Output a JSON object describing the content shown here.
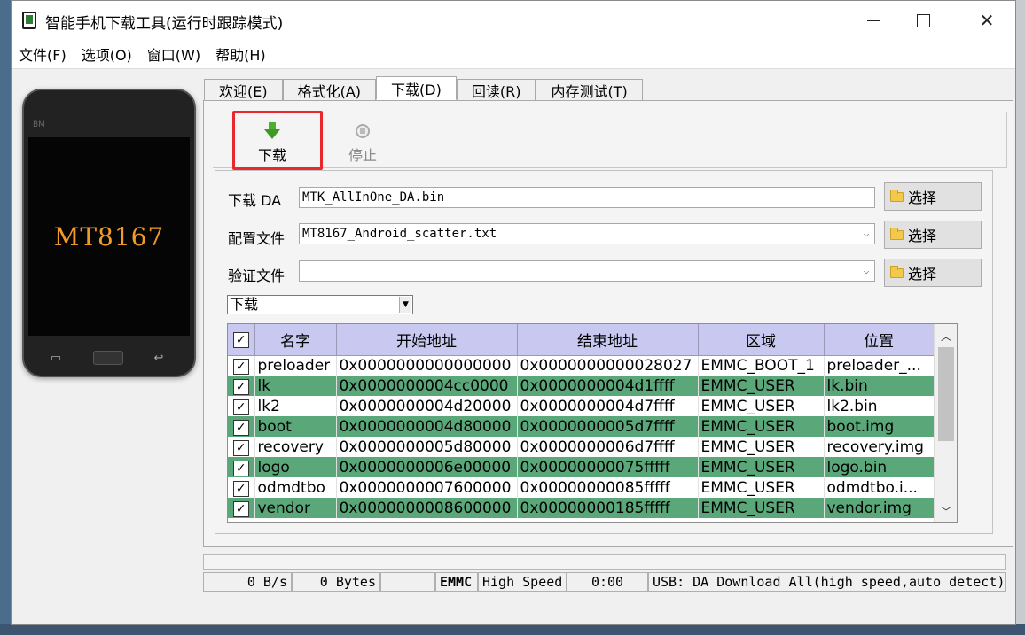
{
  "window": {
    "title": "智能手机下载工具(运行时跟踪模式)"
  },
  "menu": [
    "文件(F)",
    "选项(O)",
    "窗口(W)",
    "帮助(H)"
  ],
  "phone": {
    "brand": "BM",
    "model": "MT8167"
  },
  "tabs": [
    "欢迎(E)",
    "格式化(A)",
    "下载(D)",
    "回读(R)",
    "内存测试(T)"
  ],
  "active_tab": "下载(D)",
  "toolbar": {
    "download_label": "下载",
    "stop_label": "停止"
  },
  "fields": {
    "da_label": "下载 DA",
    "da_value": "MTK_AllInOne_DA.bin",
    "config_label": "配置文件",
    "config_value": "MT8167_Android_scatter.txt",
    "verify_label": "验证文件",
    "verify_value": "",
    "choose_label": "选择"
  },
  "mode_select": "下载",
  "table": {
    "headers": [
      "名字",
      "开始地址",
      "结束地址",
      "区域",
      "位置"
    ],
    "rows": [
      {
        "name": "preloader",
        "start": "0x0000000000000000",
        "end": "0x0000000000028027",
        "region": "EMMC_BOOT_1",
        "location": "preloader_..."
      },
      {
        "name": "lk",
        "start": "0x0000000004cc0000",
        "end": "0x0000000004d1ffff",
        "region": "EMMC_USER",
        "location": "lk.bin"
      },
      {
        "name": "lk2",
        "start": "0x0000000004d20000",
        "end": "0x0000000004d7ffff",
        "region": "EMMC_USER",
        "location": "lk2.bin"
      },
      {
        "name": "boot",
        "start": "0x0000000004d80000",
        "end": "0x0000000005d7ffff",
        "region": "EMMC_USER",
        "location": "boot.img"
      },
      {
        "name": "recovery",
        "start": "0x0000000005d80000",
        "end": "0x0000000006d7ffff",
        "region": "EMMC_USER",
        "location": "recovery.img"
      },
      {
        "name": "logo",
        "start": "0x0000000006e00000",
        "end": "0x00000000075fffff",
        "region": "EMMC_USER",
        "location": "logo.bin"
      },
      {
        "name": "odmdtbo",
        "start": "0x0000000007600000",
        "end": "0x00000000085fffff",
        "region": "EMMC_USER",
        "location": "odmdtbo.i..."
      },
      {
        "name": "vendor",
        "start": "0x0000000008600000",
        "end": "0x00000000185fffff",
        "region": "EMMC_USER",
        "location": "vendor.img"
      }
    ]
  },
  "status": {
    "speed": "0 B/s",
    "bytes": "0 Bytes",
    "storage": "EMMC",
    "mode": "High Speed",
    "time": "0:00",
    "usb": "USB: DA Download All(high speed,auto detect)"
  },
  "colors": {
    "highlight": "#e8282c",
    "row_alt": "#5aa87a",
    "header_bg": "#c8c8f0",
    "phone_model": "#f09a2a"
  }
}
